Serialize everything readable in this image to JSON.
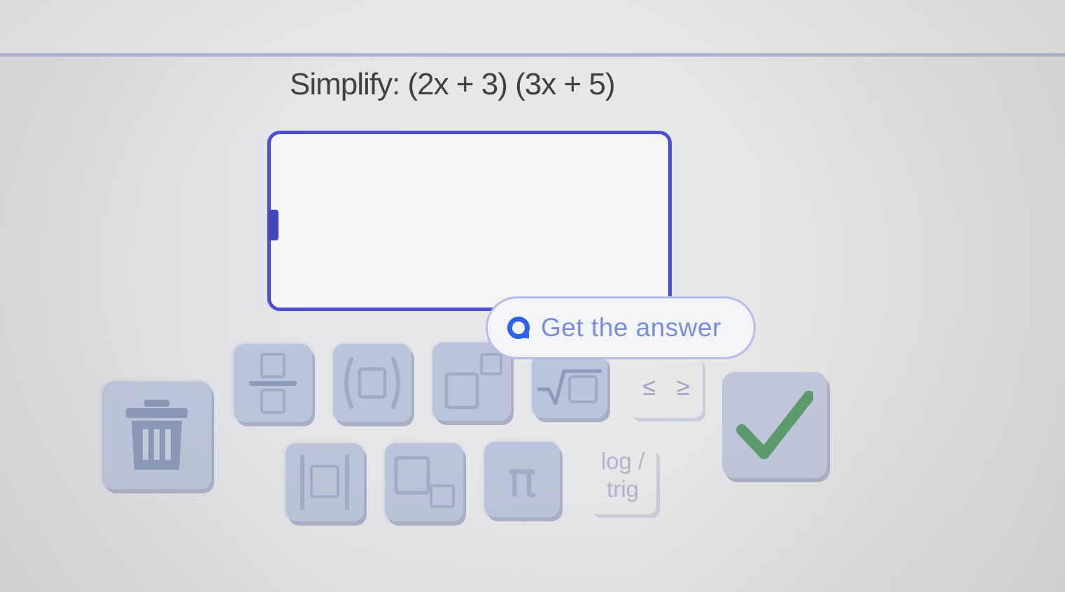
{
  "question": {
    "prefix": "Simplify:",
    "expression": "(2x + 3) (3x + 5)"
  },
  "answer_input": {
    "value": ""
  },
  "get_answer_button": {
    "label": "Get the answer"
  },
  "keypad": {
    "keys": [
      {
        "name": "trash",
        "icon": "trash-icon"
      },
      {
        "name": "fraction",
        "icon": "fraction-icon"
      },
      {
        "name": "parentheses",
        "icon": "parentheses-icon"
      },
      {
        "name": "exponent",
        "icon": "exponent-icon"
      },
      {
        "name": "square-root",
        "icon": "square-root-icon"
      },
      {
        "name": "inequalities",
        "icon": "inequality-icon"
      },
      {
        "name": "absolute-value",
        "icon": "absolute-value-icon"
      },
      {
        "name": "subscript",
        "icon": "subscript-icon"
      },
      {
        "name": "pi",
        "icon": "pi-icon"
      },
      {
        "name": "log-trig",
        "icon": "log-trig"
      },
      {
        "name": "submit",
        "icon": "checkmark-icon"
      }
    ],
    "le_symbol": "≤",
    "ge_symbol": "≥",
    "pi_symbol": "π",
    "log_trig_line1": "log /",
    "log_trig_line2": "trig"
  },
  "colors": {
    "input_border": "#4c4fd6",
    "accent_blue": "#2c63e8",
    "key_bg": "#bcc4db",
    "check_green": "#5a9a6a"
  }
}
